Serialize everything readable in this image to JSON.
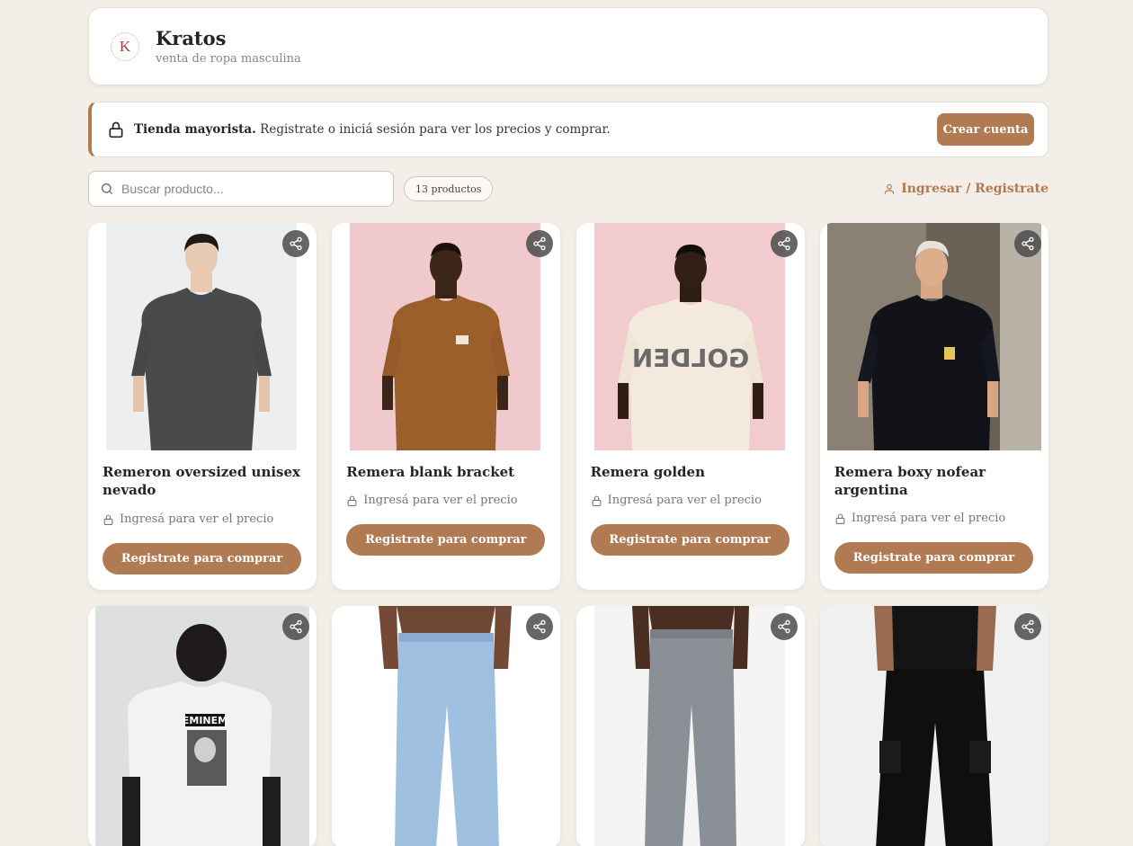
{
  "store": {
    "name": "Kratos",
    "tagline": "venta de ropa masculina",
    "logo_letter": "K"
  },
  "notice": {
    "bold": "Tienda mayorista.",
    "text": " Registrate o iniciá sesión para ver los precios y comprar.",
    "button": "Crear cuenta"
  },
  "search": {
    "placeholder": "Buscar producto...",
    "count": "13 productos",
    "login_label": "Ingresar / Registrate"
  },
  "products": [
    {
      "name": "Remeron oversized unisex nevado",
      "price_text": "Ingresá para ver el precio",
      "button": "Registrate para comprar"
    },
    {
      "name": "Remera blank bracket",
      "price_text": "Ingresá para ver el precio",
      "button": "Registrate para comprar"
    },
    {
      "name": "Remera golden",
      "price_text": "Ingresá para ver el precio",
      "button": "Registrate para comprar"
    },
    {
      "name": "Remera boxy nofear argentina",
      "price_text": "Ingresá para ver el precio",
      "button": "Registrate para comprar"
    }
  ],
  "image_texts": {
    "golden_print": "GOLDEN",
    "eminem_print": "EMINEM"
  },
  "colors": {
    "accent": "#b07a52",
    "background": "#f3efe8"
  }
}
